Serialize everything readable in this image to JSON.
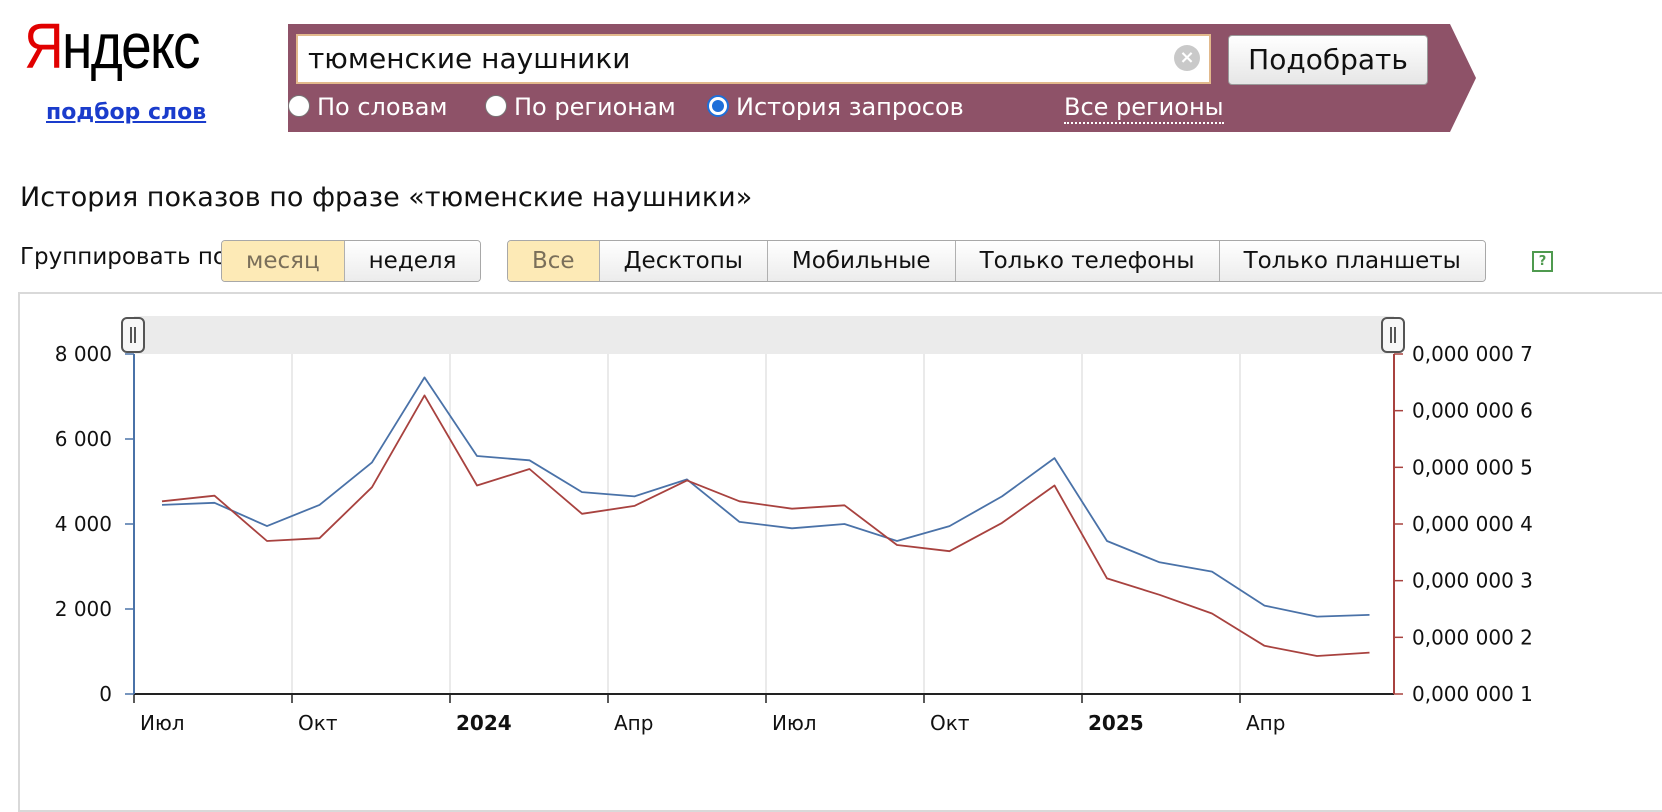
{
  "logo": {
    "first_letter": "Я",
    "rest": "ндекс"
  },
  "header": {
    "sublink": "подбор слов"
  },
  "search": {
    "query": "тюменские наушники",
    "clear_icon": "clear-icon",
    "button_label": "Подобрать",
    "modes": [
      {
        "label": "По словам",
        "selected": false
      },
      {
        "label": "По регионам",
        "selected": false
      },
      {
        "label": "История запросов",
        "selected": true
      }
    ],
    "regions_link": "Все регионы"
  },
  "page": {
    "title": "История показов по фразе «тюменские наушники»"
  },
  "grouping": {
    "label": "Группировать по:",
    "options": [
      {
        "label": "месяц",
        "active": true
      },
      {
        "label": "неделя",
        "active": false
      }
    ]
  },
  "devices": {
    "options": [
      {
        "label": "Все",
        "active": true
      },
      {
        "label": "Десктопы",
        "active": false
      },
      {
        "label": "Мобильные",
        "active": false
      },
      {
        "label": "Только телефоны",
        "active": false
      },
      {
        "label": "Только планшеты",
        "active": false
      }
    ],
    "help_icon": "?"
  },
  "chart_data": {
    "type": "line",
    "x_tick_labels": [
      "Июл",
      "Окт",
      "2024",
      "Апр",
      "Июл",
      "Окт",
      "2025",
      "Апр"
    ],
    "x_tick_bold": [
      false,
      false,
      true,
      false,
      false,
      false,
      true,
      false
    ],
    "months": [
      "2023-07",
      "2023-08",
      "2023-09",
      "2023-10",
      "2023-11",
      "2023-12",
      "2024-01",
      "2024-02",
      "2024-03",
      "2024-04",
      "2024-05",
      "2024-06",
      "2024-07",
      "2024-08",
      "2024-09",
      "2024-10",
      "2024-11",
      "2024-12",
      "2025-01",
      "2025-02",
      "2025-03",
      "2025-04",
      "2025-05",
      "2025-06"
    ],
    "y_left": {
      "ticks": [
        "8 000",
        "6 000",
        "4 000",
        "2 000",
        "0"
      ],
      "range": [
        0,
        8000
      ],
      "color": "#4a72a8"
    },
    "y_right": {
      "ticks": [
        "0,000 000 7",
        "0,000 000 6",
        "0,000 000 5",
        "0,000 000 4",
        "0,000 000 3",
        "0,000 000 2",
        "0,000 000 1"
      ],
      "range": [
        1e-07,
        7e-07
      ],
      "color": "#a8423f"
    },
    "series": [
      {
        "axis": "left",
        "color": "#4a72a8",
        "values": [
          4450,
          4500,
          3950,
          4450,
          5450,
          7450,
          5600,
          5500,
          4750,
          4650,
          5050,
          4050,
          3900,
          4000,
          3600,
          3950,
          4650,
          5550,
          3600,
          3100,
          2880,
          2080,
          1820,
          1860
        ]
      },
      {
        "axis": "right",
        "color": "#a8423f",
        "values": [
          4.4e-07,
          4.5e-07,
          3.7e-07,
          3.75e-07,
          4.65e-07,
          6.27e-07,
          4.68e-07,
          4.97e-07,
          4.18e-07,
          4.32e-07,
          4.77e-07,
          4.4e-07,
          4.27e-07,
          4.33e-07,
          3.63e-07,
          3.52e-07,
          4.02e-07,
          4.68e-07,
          3.04e-07,
          2.75e-07,
          2.42e-07,
          1.85e-07,
          1.67e-07,
          1.73e-07
        ]
      }
    ],
    "grid": "vertical",
    "range_selector": {
      "handle_icon": "||"
    }
  }
}
